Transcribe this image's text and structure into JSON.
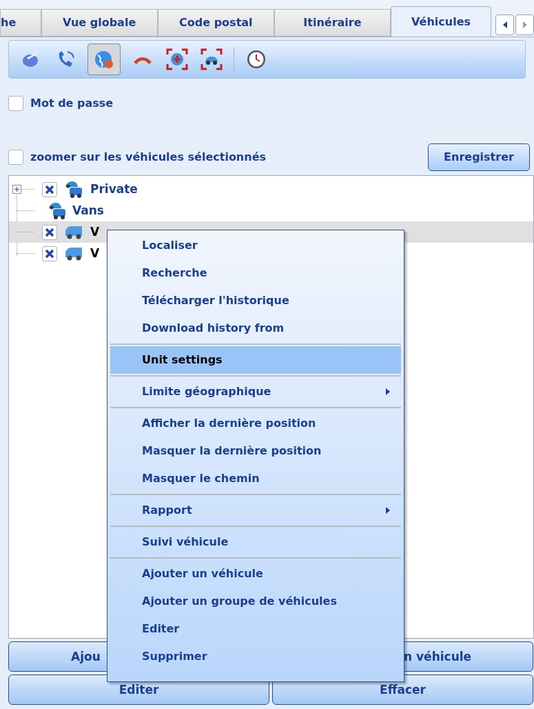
{
  "tabs": [
    {
      "label": "he",
      "selected": false
    },
    {
      "label": "Vue globale",
      "selected": false
    },
    {
      "label": "Code postal",
      "selected": false
    },
    {
      "label": "Itinéraire",
      "selected": false
    },
    {
      "label": "Véhicules",
      "selected": true
    }
  ],
  "toolbar": [
    [
      {
        "kind": "dish",
        "selected": false
      },
      {
        "kind": "phone",
        "selected": false
      },
      {
        "kind": "globe",
        "selected": true
      },
      {
        "kind": "handset",
        "selected": false
      },
      {
        "kind": "target",
        "selected": false
      },
      {
        "kind": "car-target",
        "selected": false
      }
    ],
    [
      {
        "kind": "clock",
        "selected": false
      }
    ]
  ],
  "password_option": {
    "label": "Mot de passe",
    "checked": false
  },
  "zoom_option": {
    "label": "zoomer sur les véhicules sélectionnés",
    "checked": false
  },
  "save_button": "Enregistrer",
  "tree": [
    {
      "label": "Private",
      "kind": "group",
      "checked": true,
      "expanded": false,
      "selected": false
    },
    {
      "label": "Vans",
      "kind": "group",
      "selected": false
    },
    {
      "label": "V",
      "kind": "unit",
      "checked": true,
      "selected": true
    },
    {
      "label": "V",
      "kind": "unit",
      "checked": true,
      "selected": false
    }
  ],
  "context_menu": [
    [
      {
        "label": "Localiser",
        "selected": false,
        "submenu": false
      },
      {
        "label": "Recherche",
        "selected": false,
        "submenu": false
      },
      {
        "label": "Télécharger l'historique",
        "selected": false,
        "submenu": false
      },
      {
        "label": "Download history from",
        "selected": false,
        "submenu": false
      }
    ],
    [
      {
        "label": "Unit settings",
        "selected": true,
        "submenu": false
      }
    ],
    [
      {
        "label": "Limite géographique",
        "selected": false,
        "submenu": true
      }
    ],
    [
      {
        "label": "Afficher la dernière position",
        "selected": false,
        "submenu": false
      },
      {
        "label": "Masquer la dernière position",
        "selected": false,
        "submenu": false
      },
      {
        "label": "Masquer le chemin",
        "selected": false,
        "submenu": false
      }
    ],
    [
      {
        "label": "Rapport",
        "selected": false,
        "submenu": true
      }
    ],
    [
      {
        "label": "Suivi véhicule",
        "selected": false,
        "submenu": false
      }
    ],
    [
      {
        "label": "Ajouter un véhicule",
        "selected": false,
        "submenu": false
      },
      {
        "label": "Ajouter un groupe de véhicules",
        "selected": false,
        "submenu": false
      },
      {
        "label": "Editer",
        "selected": false,
        "submenu": false
      },
      {
        "label": "Supprimer",
        "selected": false,
        "submenu": false
      }
    ]
  ],
  "bottom_buttons": [
    [
      "Ajou",
      "n véhicule"
    ],
    [
      "Editer",
      "Effacer"
    ]
  ]
}
